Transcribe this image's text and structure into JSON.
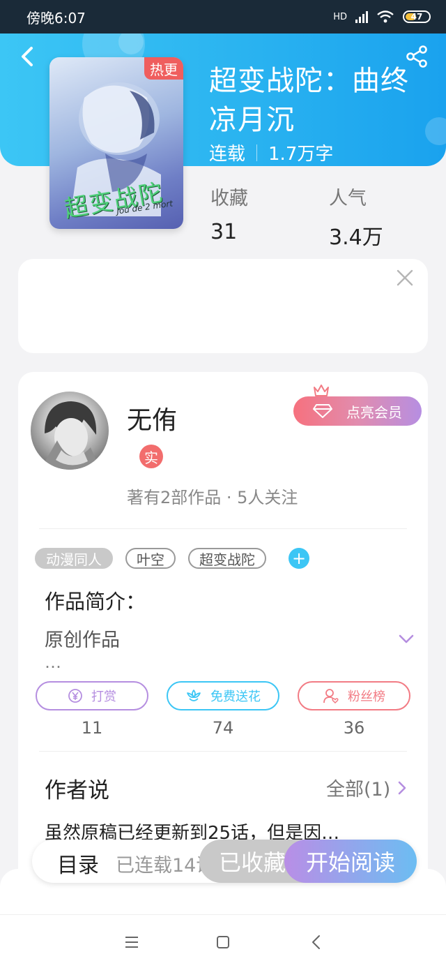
{
  "status_bar": {
    "time": "傍晚6:07",
    "network": "HD",
    "battery": "47",
    "battery_level_percent": 47,
    "icons": [
      "signal-icon",
      "wifi-icon",
      "battery-icon"
    ]
  },
  "header": {
    "back_icon": "chevron-left-icon",
    "share_icon": "share-icon"
  },
  "book": {
    "title": "超变战陀：曲终凉月沉",
    "status": "连载",
    "word_count": "1.7万字",
    "hot_tag": "热更",
    "cover_text": "超变战陀",
    "cover_subtext": "Jou de 2 mort"
  },
  "stats": {
    "favorites_label": "收藏",
    "favorites_value": "31",
    "popularity_label": "人气",
    "popularity_value": "3.4万"
  },
  "ad": {
    "close_icon": "close-icon"
  },
  "author": {
    "name": "无侑",
    "real_badge": "实",
    "summary": "著有2部作品 · 5人关注",
    "vip_label": "点亮会员"
  },
  "tags": [
    "动漫同人",
    "叶空",
    "超变战陀"
  ],
  "tag_add": "+",
  "intro": {
    "title": "作品简介：",
    "text": "原创作品",
    "ellipsis": "…"
  },
  "actions": [
    {
      "label": "打赏",
      "count": "11",
      "icon": "yen-icon",
      "color": "#b58ee0"
    },
    {
      "label": "免费送花",
      "count": "74",
      "icon": "flower-icon",
      "color": "#3cc6f5"
    },
    {
      "label": "粉丝榜",
      "count": "36",
      "icon": "fan-icon",
      "color": "#f27b84"
    }
  ],
  "author_says": {
    "title": "作者说",
    "all_label": "全部(1)",
    "text": "虽然原稿已经更新到25话，但是因…"
  },
  "bottom_bar": {
    "toc_label": "目录",
    "serial_count": "已连载14话",
    "collected_label": "已收藏",
    "start_label": "开始阅读"
  },
  "nav": {
    "menu_icon": "menu-icon",
    "home_icon": "square-icon",
    "back_icon": "back-arrow-icon"
  },
  "colors": {
    "header_blue": "#2ab3f0",
    "hot_red": "#ef5e5e",
    "accent_purple": "#b58ee0"
  }
}
